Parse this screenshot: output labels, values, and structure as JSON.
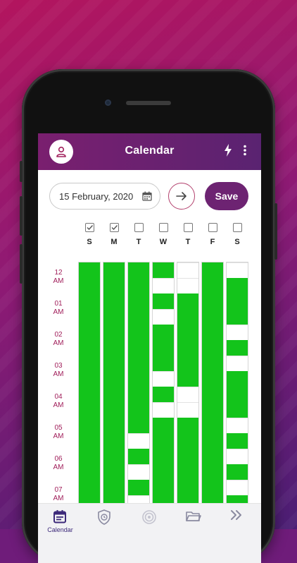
{
  "app": {
    "title": "Calendar"
  },
  "date_picker": {
    "value": "15 February, 2020"
  },
  "save_button": {
    "label": "Save"
  },
  "days": [
    {
      "letter": "S",
      "checked": true
    },
    {
      "letter": "M",
      "checked": true
    },
    {
      "letter": "T",
      "checked": false
    },
    {
      "letter": "W",
      "checked": false
    },
    {
      "letter": "T",
      "checked": false
    },
    {
      "letter": "F",
      "checked": false
    },
    {
      "letter": "S",
      "checked": false
    }
  ],
  "hours": [
    {
      "num": "12",
      "ampm": "AM"
    },
    {
      "num": "01",
      "ampm": "AM"
    },
    {
      "num": "02",
      "ampm": "AM"
    },
    {
      "num": "03",
      "ampm": "AM"
    },
    {
      "num": "04",
      "ampm": "AM"
    },
    {
      "num": "05",
      "ampm": "AM"
    },
    {
      "num": "06",
      "ampm": "AM"
    },
    {
      "num": "07",
      "ampm": "AM"
    }
  ],
  "schedule": [
    [
      1,
      1,
      1,
      1,
      1,
      1,
      1,
      1,
      1,
      1,
      1,
      1,
      1,
      1,
      1,
      1
    ],
    [
      1,
      1,
      1,
      1,
      1,
      1,
      1,
      1,
      1,
      1,
      1,
      1,
      1,
      1,
      1,
      1
    ],
    [
      1,
      1,
      1,
      1,
      1,
      1,
      1,
      1,
      1,
      1,
      1,
      0,
      1,
      0,
      1,
      0
    ],
    [
      1,
      0,
      1,
      0,
      1,
      1,
      1,
      0,
      1,
      0,
      1,
      1,
      1,
      1,
      1,
      1
    ],
    [
      0,
      0,
      1,
      1,
      1,
      1,
      1,
      1,
      0,
      0,
      1,
      1,
      1,
      1,
      1,
      1
    ],
    [
      1,
      1,
      1,
      1,
      1,
      1,
      1,
      1,
      1,
      1,
      1,
      1,
      1,
      1,
      1,
      1
    ],
    [
      0,
      1,
      1,
      1,
      0,
      1,
      0,
      1,
      1,
      1,
      0,
      1,
      0,
      1,
      0,
      1
    ]
  ],
  "nav": {
    "calendar_label": "Calendar"
  },
  "colors": {
    "accent": "#6d2372",
    "available": "#13c41b",
    "hour_label": "#a01e5a"
  }
}
